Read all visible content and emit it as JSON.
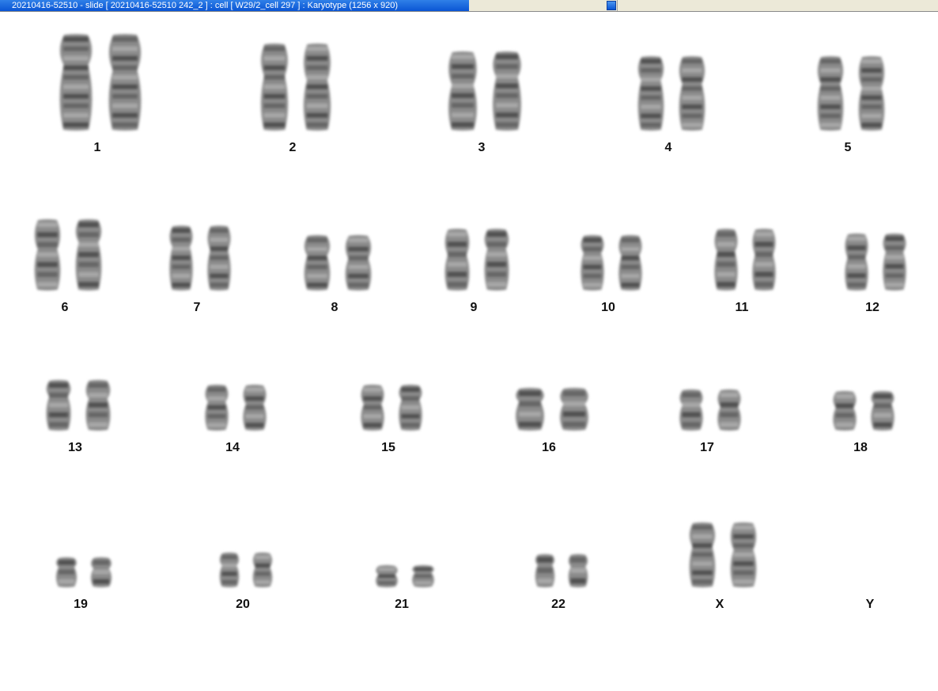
{
  "window": {
    "title": "20210416-52510 - slide [ 20210416-52510 242_2 ] : cell [ W29/2_cell 297 ] : Karyotype  (1256 x 920)"
  },
  "karyotype": {
    "chromosomes": [
      {
        "label": "1"
      },
      {
        "label": "2"
      },
      {
        "label": "3"
      },
      {
        "label": "4"
      },
      {
        "label": "5"
      },
      {
        "label": "6"
      },
      {
        "label": "7"
      },
      {
        "label": "8"
      },
      {
        "label": "9"
      },
      {
        "label": "10"
      },
      {
        "label": "11"
      },
      {
        "label": "12"
      },
      {
        "label": "13"
      },
      {
        "label": "14"
      },
      {
        "label": "15"
      },
      {
        "label": "16"
      },
      {
        "label": "17"
      },
      {
        "label": "18"
      },
      {
        "label": "19"
      },
      {
        "label": "20"
      },
      {
        "label": "21"
      },
      {
        "label": "22"
      },
      {
        "label": "X"
      },
      {
        "label": "Y"
      }
    ]
  }
}
